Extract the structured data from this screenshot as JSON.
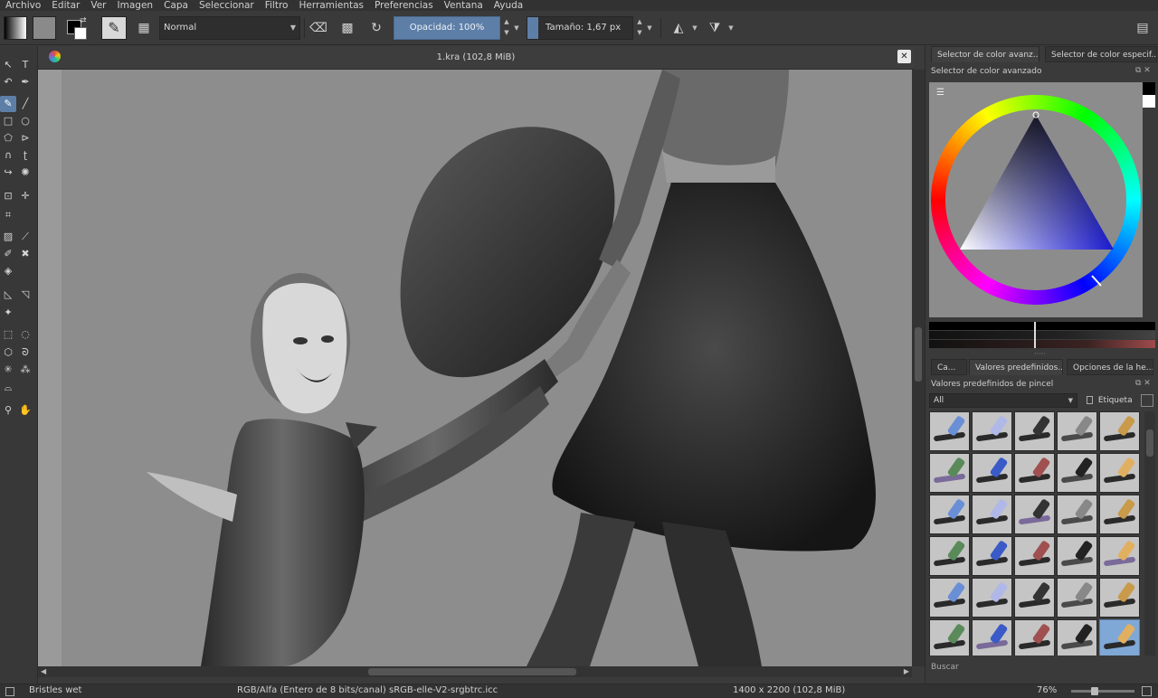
{
  "menu": [
    "Archivo",
    "Editar",
    "Ver",
    "Imagen",
    "Capa",
    "Seleccionar",
    "Filtro",
    "Herramientas",
    "Preferencias",
    "Ventana",
    "Ayuda"
  ],
  "toolbar": {
    "blend_mode": "Normal",
    "opacity_label": "Opacidad:  100%",
    "opacity_value": 100,
    "size_label": "Tamaño:  1,67 px"
  },
  "document": {
    "title": "1.kra (102,8 MiB)"
  },
  "docker": {
    "tabs_top": [
      "Selector de color avanz...",
      "Selector de color especif..."
    ],
    "color_panel_title": "Selector de color avanzado",
    "tabs_bottom": [
      "Ca...",
      "Valores predefinidos...",
      "Opciones de la he..."
    ],
    "presets_panel_title": "Valores predefinidos de pincel",
    "presets_filter": "All",
    "tag_label": "Etiqueta",
    "search_label": "Buscar"
  },
  "status": {
    "brush": "Bristles wet",
    "color_space": "RGB/Alfa (Entero de 8 bits/canal)  sRGB-elle-V2-srgbtrc.icc",
    "dimensions": "1400 x 2200 (102,8 MiB)",
    "zoom": "76%"
  },
  "colors": {
    "accent": "#5d7fa7",
    "selected_color": "#1a1ad0",
    "canvas_bg": "#8d8d8d"
  }
}
